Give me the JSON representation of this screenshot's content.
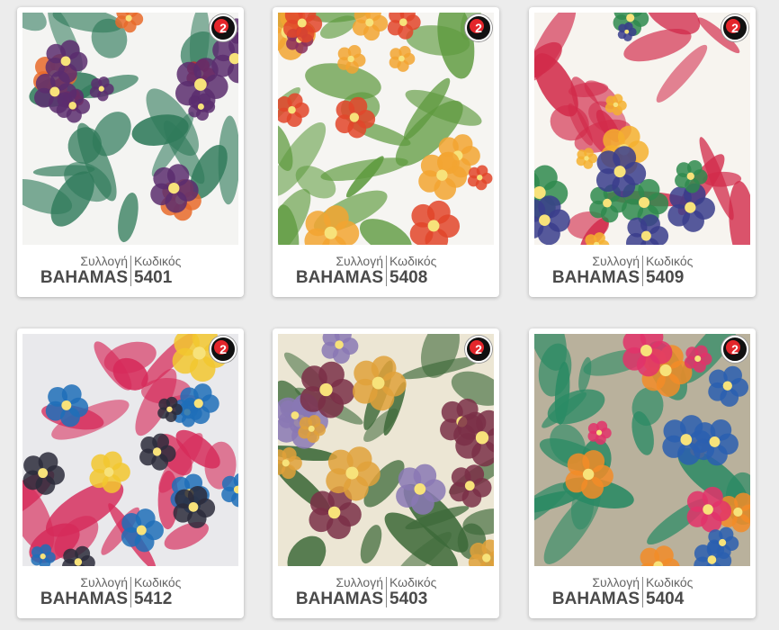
{
  "products": [
    {
      "collection_label": "Συλλογή",
      "code_label": "Κωδικός",
      "collection": "BAHAMAS",
      "code": "5401",
      "badge": "2",
      "palette": [
        "#f4f4f2",
        "#2f7a5a",
        "#c8232d",
        "#5b2d6e",
        "#e86a2a"
      ]
    },
    {
      "collection_label": "Συλλογή",
      "code_label": "Κωδικός",
      "collection": "BAHAMAS",
      "code": "5408",
      "badge": "2",
      "palette": [
        "#f6f5f2",
        "#5e9a3e",
        "#e2452a",
        "#8a2f5e",
        "#f2a531"
      ]
    },
    {
      "collection_label": "Συλλογή",
      "code_label": "Κωδικός",
      "collection": "BAHAMAS",
      "code": "5409",
      "badge": "2",
      "palette": [
        "#f7f4ef",
        "#d22a4a",
        "#3a3d8c",
        "#2f8a4e",
        "#f4b02f"
      ]
    },
    {
      "collection_label": "Συλλογή",
      "code_label": "Κωδικός",
      "collection": "BAHAMAS",
      "code": "5412",
      "badge": "2",
      "palette": [
        "#e9e9ec",
        "#d62b5a",
        "#1f6fb8",
        "#f2c72f",
        "#2b2b3b"
      ]
    },
    {
      "collection_label": "Συλλογή",
      "code_label": "Κωδικός",
      "collection": "BAHAMAS",
      "code": "5403",
      "badge": "2",
      "palette": [
        "#ece6d4",
        "#3e6a3a",
        "#7a2f46",
        "#e0a13a",
        "#8a78b4"
      ]
    },
    {
      "collection_label": "Συλλογή",
      "code_label": "Κωδικός",
      "collection": "BAHAMAS",
      "code": "5404",
      "badge": "2",
      "palette": [
        "#b9b19c",
        "#2a8a64",
        "#e2336a",
        "#f28c28",
        "#2a5fb0"
      ]
    }
  ]
}
